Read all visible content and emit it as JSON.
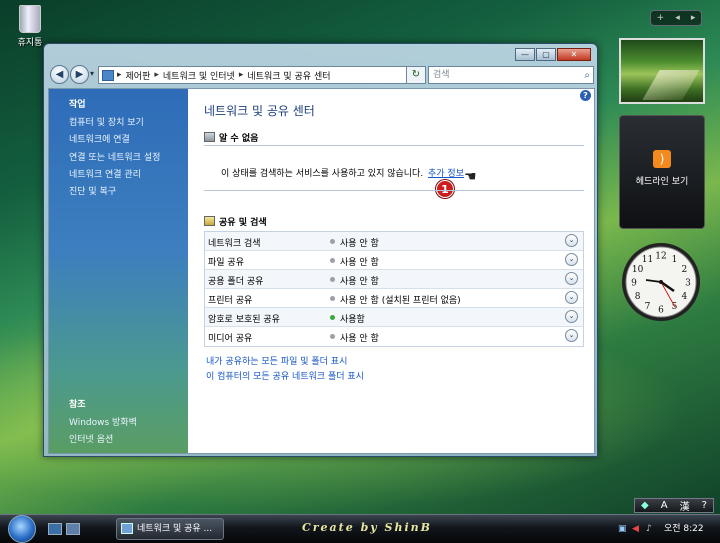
{
  "desktop": {
    "recycle_label": "휴지통"
  },
  "gadgets": {
    "sidebar_controls": [
      "+",
      "◂",
      "▸"
    ],
    "rss_label": "헤드라인 보기",
    "clock": {
      "numbers": [
        "12",
        "1",
        "2",
        "3",
        "4",
        "5",
        "6",
        "7",
        "8",
        "9",
        "10",
        "11"
      ]
    }
  },
  "window": {
    "controls": {
      "minimize": "—",
      "maximize": "▢",
      "close": "✕"
    },
    "nav": {
      "back": "◀",
      "forward": "▶",
      "dropdown": "▾"
    },
    "address": {
      "segments": [
        "제어판",
        "네트워크 및 인터넷",
        "네트워크 및 공유 센터"
      ],
      "separator": "▸",
      "lead": "▸"
    },
    "refresh": "↻",
    "search": {
      "placeholder": "검색",
      "icon": "⌕"
    },
    "sidebar": {
      "tasks_header": "작업",
      "tasks": [
        "컴퓨터 및 장치 보기",
        "네트워크에 연결",
        "연결 또는 네트워크 설정",
        "네트워크 연결 관리",
        "진단 및 복구"
      ],
      "see_also_header": "참조",
      "see_also": [
        "Windows 방화벽",
        "인터넷 옵션"
      ]
    },
    "main": {
      "help": "?",
      "title": "네트워크 및 공유 센터",
      "unknown_header": "알 수 없음",
      "status_text": "이 상태를 검색하는 서비스를 사용하고 있지 않습니다.",
      "more_info": "추가 정보",
      "annotation": "1",
      "sharing_header": "공유 및 검색",
      "sharing_rows": [
        {
          "name": "네트워크 검색",
          "value": "사용 안 함",
          "on": false
        },
        {
          "name": "파일 공유",
          "value": "사용 안 함",
          "on": false
        },
        {
          "name": "공용 폴더 공유",
          "value": "사용 안 함",
          "on": false
        },
        {
          "name": "프린터 공유",
          "value": "사용 안 함 (설치된 프린터 없음)",
          "on": false
        },
        {
          "name": "암호로 보호된 공유",
          "value": "사용함",
          "on": true
        },
        {
          "name": "미디어 공유",
          "value": "사용 안 함",
          "on": false
        }
      ],
      "expand_glyph": "⌄",
      "links": [
        "내가 공유하는 모든 파일 및 폴더 표시",
        "이 컴퓨터의 모든 공유 네트워크 폴더 표시"
      ]
    }
  },
  "taskbar": {
    "task_button": "네트워크 및 공유 ...",
    "watermark": "Create by ShinB",
    "ime": {
      "mode": "A",
      "hanja": "漢",
      "help": "?"
    },
    "clock": "오전 8:22"
  }
}
